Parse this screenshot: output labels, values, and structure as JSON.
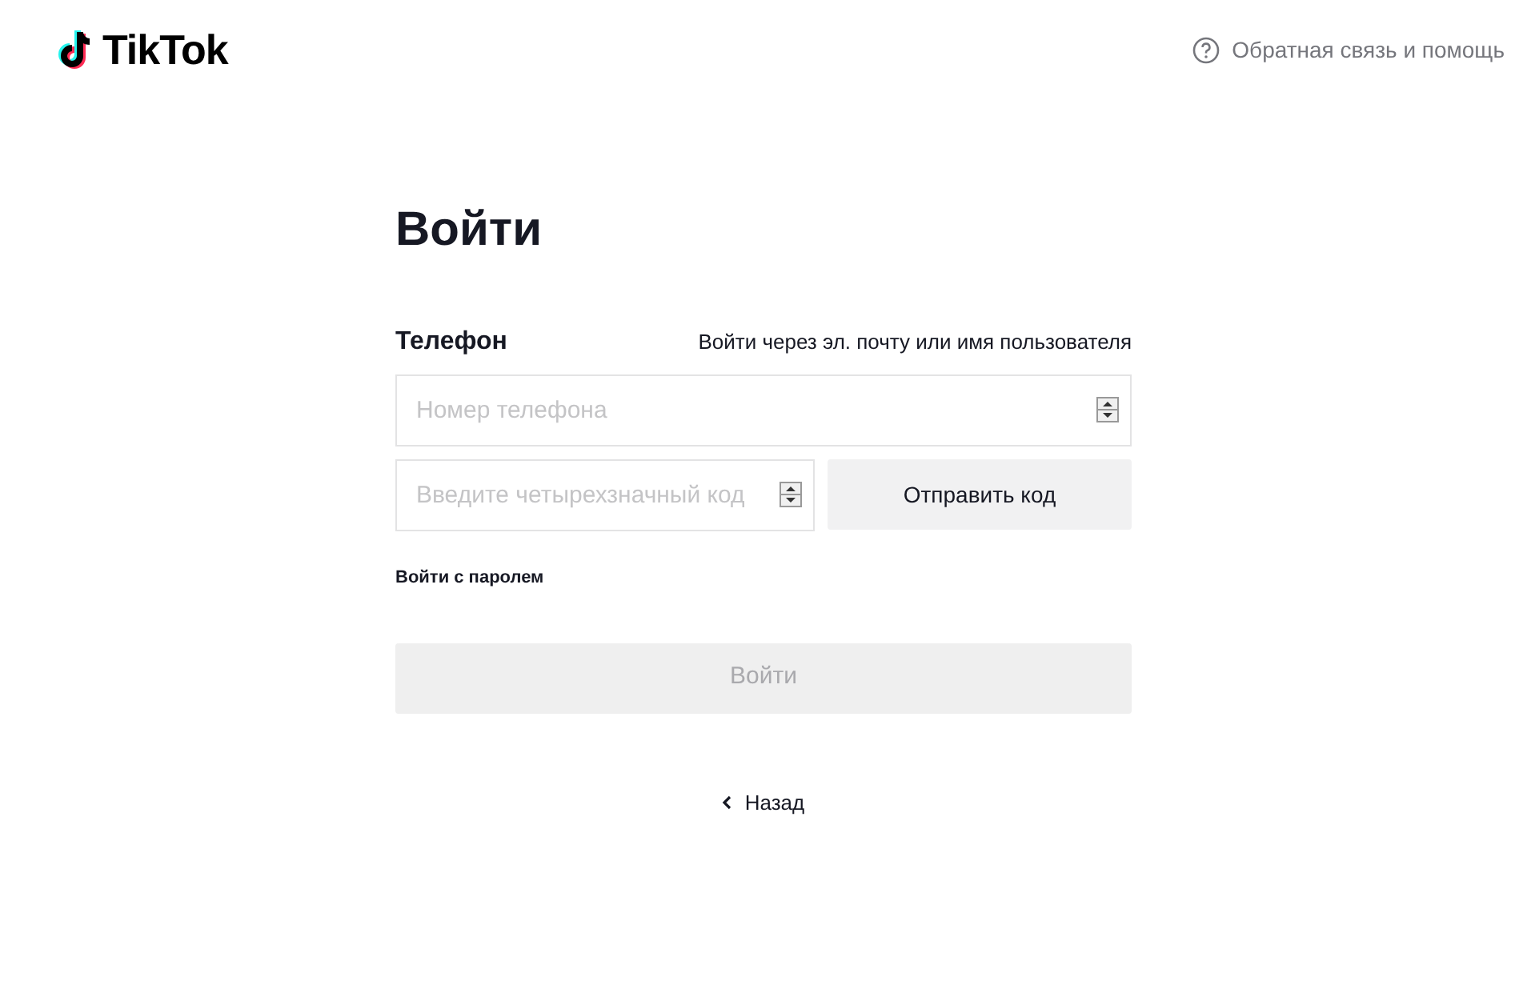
{
  "header": {
    "logo": "TikTok",
    "help_link": "Обратная связь и помощь"
  },
  "title": "Войти",
  "method_label": "Телефон",
  "switch_link": "Войти через эл. почту или имя пользователя",
  "phone_field": {
    "placeholder": "Номер телефона"
  },
  "code_field": {
    "placeholder": "Введите четырехзначный код"
  },
  "send_code_button": "Отправить код",
  "password_link": "Войти с паролем",
  "submit_button": {
    "label": "Войти",
    "disabled": true
  },
  "back_link": "Назад"
}
